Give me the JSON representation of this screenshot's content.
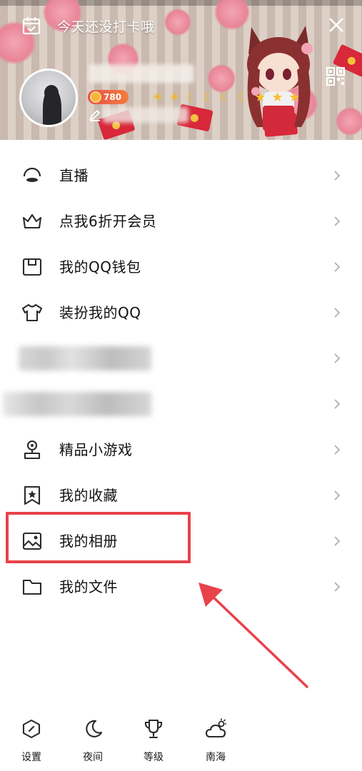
{
  "header": {
    "checkin_text": "今天还没打卡哦",
    "coin_value": "780",
    "level_icons": [
      "sun-icon",
      "sun-icon",
      "moon-icon",
      "moon-icon",
      "moon-icon",
      "moon-icon",
      "star-icon",
      "star-icon",
      "star-icon"
    ]
  },
  "menu": {
    "items": [
      {
        "label": "直播",
        "icon": "live-icon"
      },
      {
        "label": "点我6折开会员",
        "icon": "crown-icon"
      },
      {
        "label": "我的QQ钱包",
        "icon": "wallet-icon"
      },
      {
        "label": "装扮我的QQ",
        "icon": "tshirt-icon"
      },
      {
        "label": "",
        "icon": "blurred"
      },
      {
        "label": "",
        "icon": "blurred"
      },
      {
        "label": "精品小游戏",
        "icon": "game-icon"
      },
      {
        "label": "我的收藏",
        "icon": "bookmark-icon"
      },
      {
        "label": "我的相册",
        "icon": "album-icon"
      },
      {
        "label": "我的文件",
        "icon": "folder-icon"
      }
    ]
  },
  "bottom_bar": {
    "settings": "设置",
    "night": "夜间",
    "level": "等级",
    "weather": "南海"
  },
  "colors": {
    "highlight": "#e8424a",
    "text": "#111111",
    "chevron": "#b0b0b0"
  }
}
